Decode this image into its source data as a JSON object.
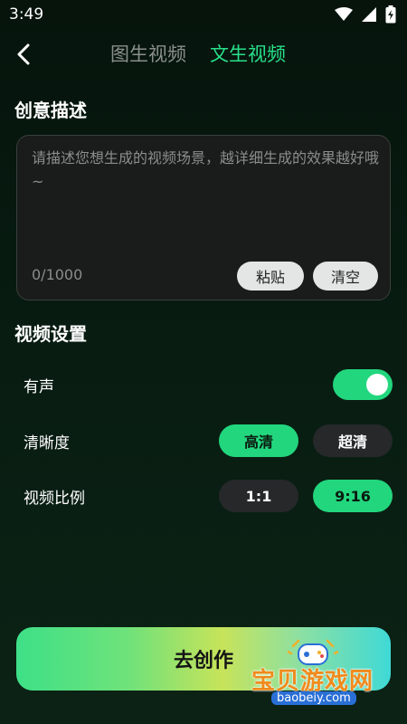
{
  "status_bar": {
    "time": "3:49"
  },
  "header": {
    "tabs": [
      {
        "label": "图生视频",
        "active": false
      },
      {
        "label": "文生视频",
        "active": true
      }
    ]
  },
  "creative": {
    "title": "创意描述",
    "placeholder": "请描述您想生成的视频场景，越详细生成的效果越好哦~",
    "value": "",
    "char_count": "0/1000",
    "paste_label": "粘贴",
    "clear_label": "清空"
  },
  "settings": {
    "title": "视频设置",
    "sound": {
      "label": "有声",
      "enabled": true
    },
    "clarity": {
      "label": "清晰度",
      "options": [
        {
          "label": "高清",
          "selected": true
        },
        {
          "label": "超清",
          "selected": false
        }
      ]
    },
    "ratio": {
      "label": "视频比例",
      "options": [
        {
          "label": "1:1",
          "selected": false
        },
        {
          "label": "9:16",
          "selected": true
        }
      ]
    }
  },
  "create_button": {
    "label": "去创作"
  },
  "watermark": {
    "text": "宝贝游戏网",
    "url": "baobeiy.com"
  },
  "colors": {
    "accent": "#22d67d",
    "active_tab": "#28e08a"
  }
}
